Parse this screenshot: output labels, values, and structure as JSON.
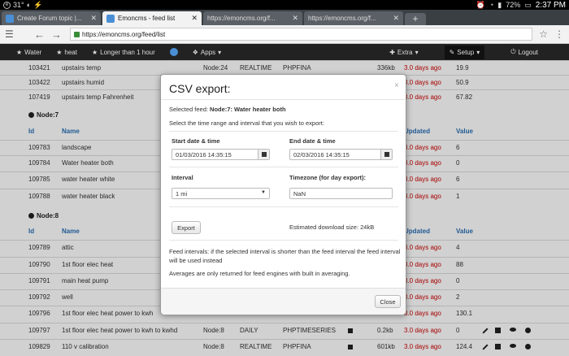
{
  "statusbar": {
    "temperature": "31°",
    "battery": "72%",
    "time": "2:37 PM"
  },
  "tabs": [
    {
      "title": "Create Forum topic |...",
      "active": false
    },
    {
      "title": "Emoncms - feed list",
      "active": true
    },
    {
      "title": "https://emoncms.org/f...",
      "active": false
    },
    {
      "title": "https://emoncms.org/f...",
      "active": false
    }
  ],
  "address": {
    "url": "https://emoncms.org/feed/list"
  },
  "navbar": {
    "items": [
      "Water",
      "heat",
      "Longer than 1 hour",
      "Apps"
    ],
    "right": [
      "Extra",
      "Setup",
      "Logout"
    ]
  },
  "table": {
    "headers": {
      "id": "Id",
      "name": "Name",
      "updated": "Updated",
      "value": "Value"
    },
    "top_rows": [
      {
        "id": "103421",
        "name": "upstairs temp",
        "tag": "Node:24",
        "mode": "REALTIME",
        "engine": "PHPFINA",
        "size": "336kb",
        "updated": "3.0 days ago",
        "value": "19.9"
      },
      {
        "id": "103422",
        "name": "upstairs humid",
        "updated": "3.0 days ago",
        "value": "50.9"
      },
      {
        "id": "107419",
        "name": "upstairs temp Fahrenheit",
        "updated": "3.0 days ago",
        "value": "67.82"
      }
    ],
    "group7": "Node:7",
    "node7_rows": [
      {
        "id": "109783",
        "name": "landscape",
        "updated": "3.0 days ago",
        "value": "6"
      },
      {
        "id": "109784",
        "name": "Water heater both",
        "updated": "3.0 days ago",
        "value": "0"
      },
      {
        "id": "109785",
        "name": "water heater white",
        "updated": "3.0 days ago",
        "value": "6"
      },
      {
        "id": "109788",
        "name": "water heater black",
        "updated": "3.0 days ago",
        "value": "1"
      }
    ],
    "group8": "Node:8",
    "node8_rows": [
      {
        "id": "109789",
        "name": "attic",
        "updated": "3.0 days ago",
        "value": "4"
      },
      {
        "id": "109790",
        "name": "1st floor elec heat",
        "updated": "3.0 days ago",
        "value": "88"
      },
      {
        "id": "109791",
        "name": "main heat pump",
        "updated": "3.0 days ago",
        "value": "0"
      },
      {
        "id": "109792",
        "name": "well",
        "updated": "3.0 days ago",
        "value": "2"
      },
      {
        "id": "109796",
        "name": "1st floor elec heat power to kwh",
        "updated": "3.0 days ago",
        "value": "130.1"
      },
      {
        "id": "109797",
        "name": "1st floor elec heat power to kwh to kwhd",
        "tag": "Node:8",
        "mode": "DAILY",
        "engine": "PHPTIMESERIES",
        "size": "0.2kb",
        "updated": "3.0 days ago",
        "value": "0"
      },
      {
        "id": "109829",
        "name": "110 v calibration",
        "tag": "Node:8",
        "mode": "REALTIME",
        "engine": "PHPFINA",
        "size": "601kb",
        "updated": "3.0 days ago",
        "value": "124.4"
      }
    ]
  },
  "modal": {
    "title": "CSV export:",
    "close": "×",
    "feed_prefix": "Selected feed: ",
    "feed_name": "Node:7: Water heater both",
    "instruction": "Select the time range and interval that you wish to export:",
    "start_label": "Start date & time",
    "start_value": "01/03/2016 14:35:15",
    "end_label": "End date & time",
    "end_value": "02/03/2016 14:35:15",
    "interval_label": "Interval",
    "interval_value": "1 mi",
    "timezone_label": "Timezone (for day export):",
    "timezone_value": "NaN",
    "export_button": "Export",
    "download_size": "Estimated download size: 24kB",
    "note_intervals": "Feed intervals: if the selected interval is shorter than the feed interval the feed interval will be used instead",
    "note_averages": "Averages are only returned for feed engines with built in averaging.",
    "close_button": "Close"
  }
}
